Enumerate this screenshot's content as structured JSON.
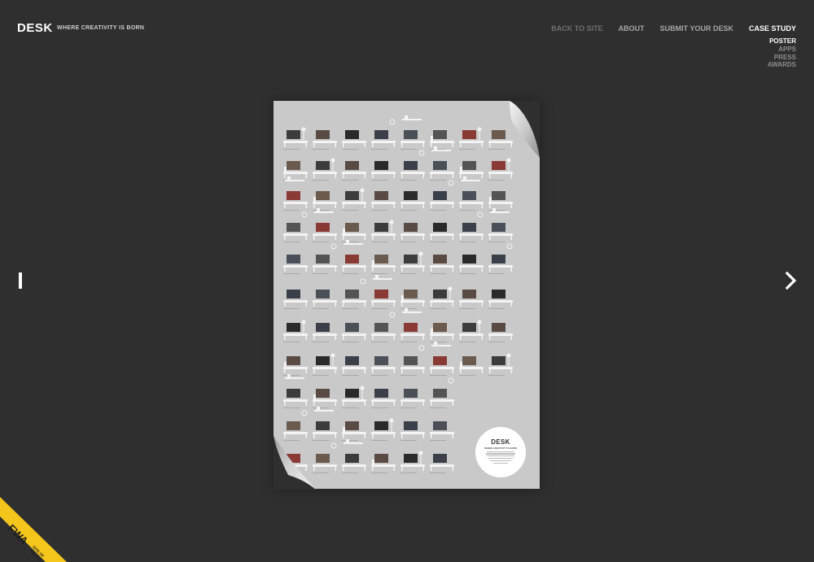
{
  "brand": {
    "logo": "DESK",
    "tagline": "WHERE CREATIVITY IS BORN"
  },
  "nav": {
    "items": [
      {
        "label": "BACK TO SITE"
      },
      {
        "label": "ABOUT"
      },
      {
        "label": "SUBMIT YOUR DESK"
      },
      {
        "label": "CASE STUDY"
      }
    ],
    "subitems": [
      {
        "label": "POSTER"
      },
      {
        "label": "APPS"
      },
      {
        "label": "PRESS"
      },
      {
        "label": "AWARDS"
      }
    ]
  },
  "poster": {
    "circle_title": "DESK",
    "circle_subtitle": "WHERE CREATIVITY IS BORN"
  },
  "badge": {
    "logo_text": "FWA",
    "line1": "SITE OF",
    "line2": "THE DAY",
    "color": "#f4c51b"
  },
  "colors": {
    "background": "#2f2f2f",
    "poster": "#c9c9c9"
  }
}
